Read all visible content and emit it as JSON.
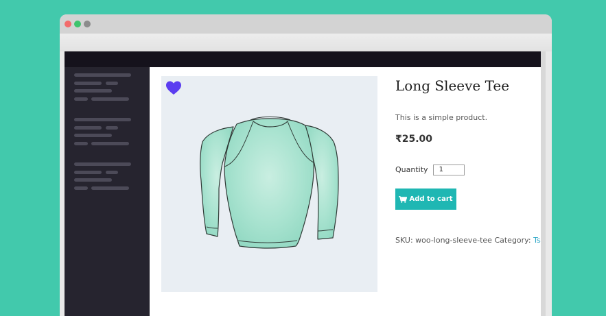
{
  "colors": {
    "background": "#42c9ac",
    "admin_bar": "#15121c",
    "sidebar": "#26242f",
    "accent_button": "#1fb7b3",
    "heart": "#5b3df0",
    "link": "#2ea7c7"
  },
  "window_controls": [
    "close-dot",
    "maximize-dot",
    "minimize-dot"
  ],
  "product": {
    "title": "Long Sleeve Tee",
    "short_description": "This is a simple product.",
    "price": "₹25.00",
    "quantity_label": "Quantity",
    "quantity_value": "1",
    "add_to_cart_label": "Add to cart",
    "sku_label": "SKU:",
    "sku_value": "woo-long-sleeve-tee",
    "category_label": "Category:",
    "category_value": "Tshirts",
    "image_icon": "long-sleeve-shirt-illustration",
    "wishlist_icon": "heart-icon",
    "cart_icon": "shopping-cart-icon"
  }
}
